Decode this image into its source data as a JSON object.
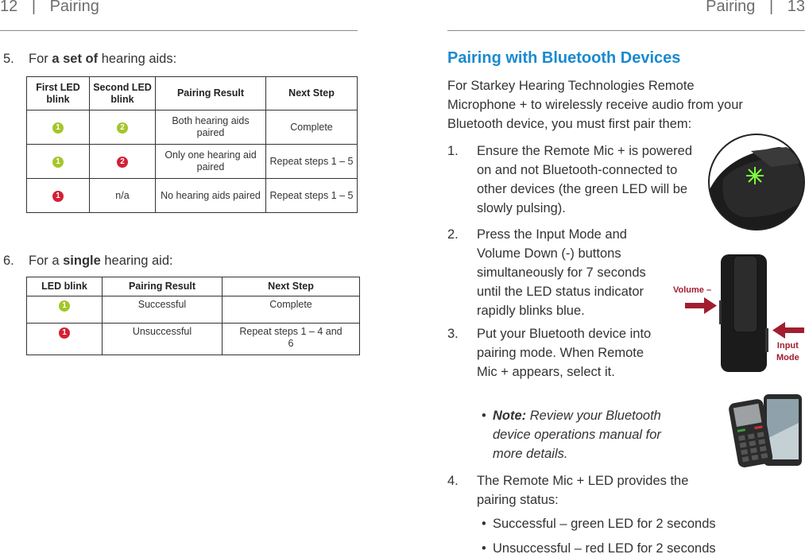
{
  "left_page": {
    "page_number": "12",
    "separator": "|",
    "section": "Pairing",
    "step5": {
      "number": "5.",
      "prefix": "For ",
      "bold": "a set of",
      "suffix": " hearing aids:"
    },
    "set_table": {
      "headers": [
        "First LED blink",
        "Second LED blink",
        "Pairing Result",
        "Next Step"
      ],
      "rows": [
        {
          "first": {
            "label": "1",
            "color": "#a4c62a"
          },
          "second": {
            "label": "2",
            "color": "#a4c62a"
          },
          "result": "Both hearing aids paired",
          "next": "Complete"
        },
        {
          "first": {
            "label": "1",
            "color": "#a4c62a"
          },
          "second": {
            "label": "2",
            "color": "#d51f35"
          },
          "result": "Only one hearing aid paired",
          "next": "Repeat steps 1 – 5"
        },
        {
          "first": {
            "label": "1",
            "color": "#d51f35"
          },
          "second_text": "n/a",
          "result": "No hearing aids paired",
          "next": "Repeat steps 1 – 5"
        }
      ]
    },
    "step6": {
      "number": "6.",
      "prefix": "For a ",
      "bold": "single",
      "suffix": " hearing aid:"
    },
    "single_table": {
      "headers": [
        "LED blink",
        "Pairing Result",
        "Next Step"
      ],
      "rows": [
        {
          "blink": {
            "label": "1",
            "color": "#a4c62a"
          },
          "result": "Successful",
          "next": "Complete"
        },
        {
          "blink": {
            "label": "1",
            "color": "#d51f35"
          },
          "result": "Unsuccessful",
          "next": "Repeat steps 1 – 4 and 6"
        }
      ]
    }
  },
  "right_page": {
    "section": "Pairing",
    "separator": "|",
    "page_number": "13",
    "heading": "Pairing with Bluetooth Devices",
    "intro": "For Starkey Hearing Technologies Remote Microphone + to wirelessly receive audio from your Bluetooth device, you must first pair them:",
    "steps": [
      {
        "number": "1.",
        "text": "Ensure the Remote Mic + is powered on and not Bluetooth-connected to other devices (the green LED will be slowly pulsing)."
      },
      {
        "number": "2.",
        "text": "Press the Input Mode and Volume Down (-) buttons simultaneously for 7 seconds until the LED status indicator rapidly blinks blue."
      },
      {
        "number": "3.",
        "text": "Put your Bluetooth device into pairing mode. When Remote Mic + appears, select it."
      },
      {
        "number": "4.",
        "text": "The Remote Mic + LED provides the pairing status:"
      }
    ],
    "note": {
      "bullet": "•",
      "label": "Note:",
      "text": " Review your Bluetooth device operations manual for more details."
    },
    "status_bullets": [
      "Successful – green LED for 2 seconds",
      "Unsuccessful – red LED for 2 seconds"
    ],
    "callouts": {
      "volume": "Volume –",
      "input_line1": "Input",
      "input_line2": "Mode"
    },
    "colors": {
      "heading": "#1a8ad0",
      "callout": "#a21d2f",
      "led_green": "#7cff3a"
    }
  }
}
